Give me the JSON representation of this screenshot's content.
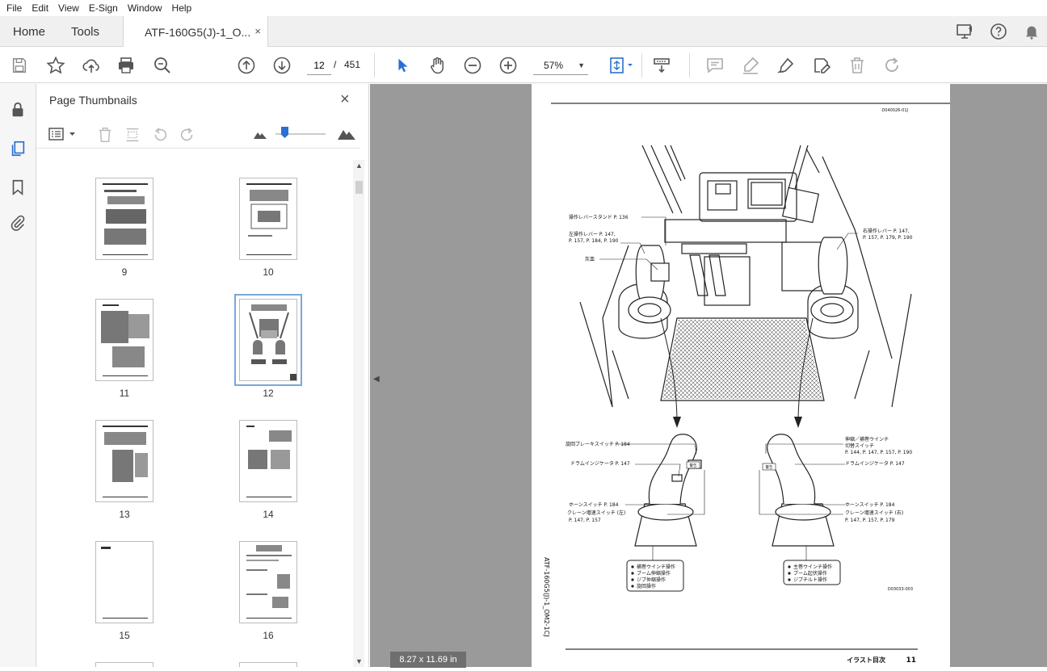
{
  "menu": [
    "File",
    "Edit",
    "View",
    "E-Sign",
    "Window",
    "Help"
  ],
  "tabs": {
    "home": "Home",
    "tools": "Tools",
    "document": "ATF-160G5(J)-1_O...",
    "close": "×"
  },
  "toolbar": {
    "current_page": "12",
    "page_separator": "/",
    "total_pages": "451",
    "zoom": "57%"
  },
  "panel": {
    "title": "Page Thumbnails",
    "close": "×",
    "thumbnails": [
      {
        "label": "9"
      },
      {
        "label": "10"
      },
      {
        "label": "11"
      },
      {
        "label": "12",
        "selected": true
      },
      {
        "label": "13"
      },
      {
        "label": "14"
      },
      {
        "label": "15"
      },
      {
        "label": "16"
      }
    ]
  },
  "document": {
    "doc_code": "D040026-01J",
    "side_code": "ATF-160G5(J)-1_OM2-1CJ",
    "fig_code": "D03033-003",
    "footer_title": "イラスト目次",
    "footer_page": "11",
    "page_size": "8.27 x 11.69 in",
    "labels": {
      "lever_stand": "操作レバースタンド P. 136",
      "left_lever_1": "左操作レバー P. 147,",
      "left_lever_2": "P. 157, P. 184, P. 190",
      "ashtray": "灰皿",
      "right_lever_1": "右操作レバー P. 147,",
      "right_lever_2": "P. 157, P. 179, P. 190",
      "swing_brake": "旋回ブレーキスイッチ P. 184",
      "drum_left": "ドラムインジケータ P. 147",
      "horn_left": "ホーンスイッチ P. 184",
      "speed_left_1": "クレーン増速スイッチ (左)",
      "speed_left_2": "P. 147, P. 157",
      "telescope_1": "伸縮／補巻ウインチ",
      "telescope_2": "切替スイッチ",
      "telescope_3": "P. 144, P. 147, P. 157, P. 190",
      "drum_right": "ドラムインジケータ P. 147",
      "horn_right": "ホーンスイッチ P. 184",
      "speed_right_1": "クレーン増速スイッチ (右)",
      "speed_right_2": "P. 147, P. 157, P. 179",
      "left_ops": [
        "補巻ウインチ操作",
        "ブーム伸縮操作",
        "ジブ仲縮操作",
        "旋回操作"
      ],
      "right_ops": [
        "主巻ウインチ操作",
        "ブーム起伏操作",
        "ジブチルト操作"
      ],
      "sticker": "警告"
    }
  }
}
